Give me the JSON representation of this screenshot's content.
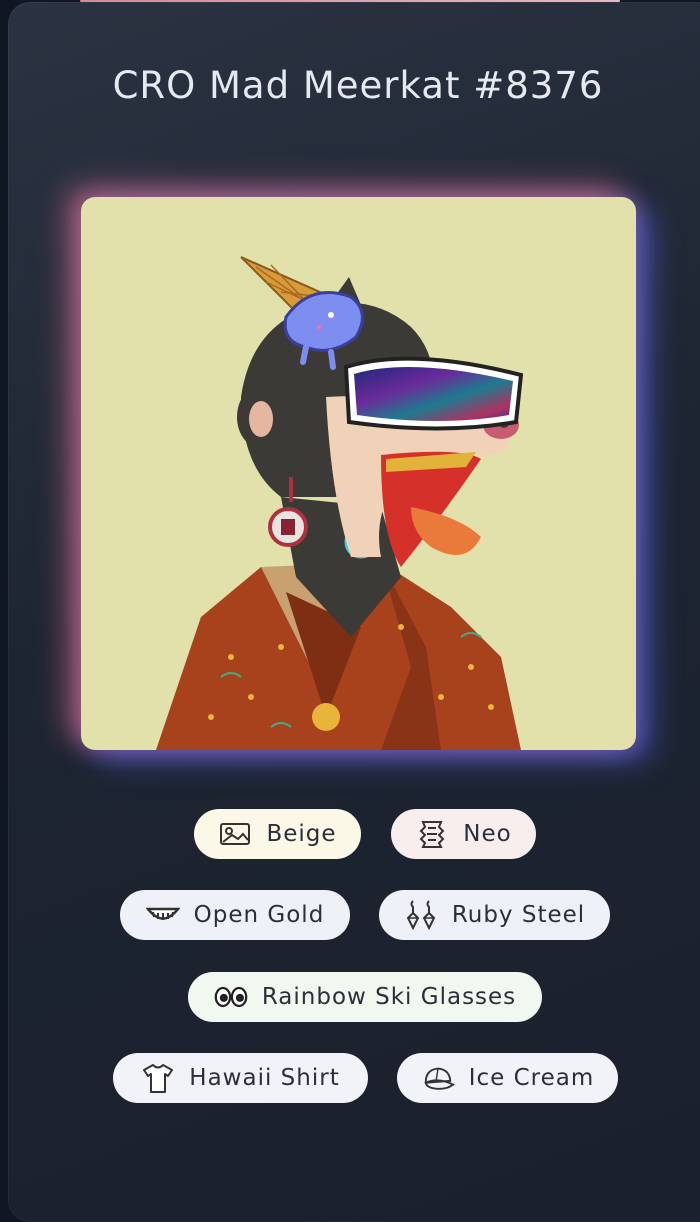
{
  "title": "CRO Mad Meerkat #8376",
  "artwork": {
    "background_color": "#e2e1ab"
  },
  "traits": [
    {
      "label": "Beige",
      "icon": "image-icon",
      "bg": "#fbf8e8"
    },
    {
      "label": "Neo",
      "icon": "fur-pattern-icon",
      "bg": "#f8eeee"
    },
    {
      "label": "Open Gold",
      "icon": "grin-mouth-icon",
      "bg": "#eef1f7"
    },
    {
      "label": "Ruby Steel",
      "icon": "earrings-icon",
      "bg": "#eef1f7"
    },
    {
      "label": "Rainbow Ski Glasses",
      "icon": "eyes-icon",
      "bg": "#f1f8f0"
    },
    {
      "label": "Hawaii Shirt",
      "icon": "shirt-icon",
      "bg": "#f1f3f8"
    },
    {
      "label": "Ice Cream",
      "icon": "cap-icon",
      "bg": "#f1f3f8"
    }
  ]
}
